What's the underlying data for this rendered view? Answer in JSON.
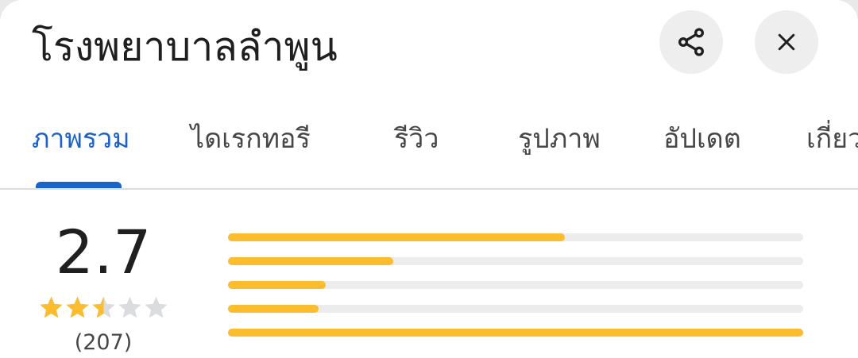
{
  "header": {
    "title": "โรงพยาบาลลำพูน"
  },
  "tabs": [
    {
      "label": "ภาพรวม",
      "active": true
    },
    {
      "label": "ไดเรกทอรี",
      "active": false
    },
    {
      "label": "รีวิว",
      "active": false
    },
    {
      "label": "รูปภาพ",
      "active": false
    },
    {
      "label": "อัปเดต",
      "active": false
    },
    {
      "label": "เกี่ยว",
      "active": false
    }
  ],
  "rating": {
    "value": "2.7",
    "stars_filled": 2.5,
    "stars_total": 5,
    "count": "(207)"
  },
  "rating_distribution": [
    {
      "stars": 5,
      "fraction": 0.585
    },
    {
      "stars": 4,
      "fraction": 0.287
    },
    {
      "stars": 3,
      "fraction": 0.17
    },
    {
      "stars": 2,
      "fraction": 0.158
    },
    {
      "stars": 1,
      "fraction": 1.0
    }
  ],
  "colors": {
    "accent": "#1a64c9",
    "star": "#fbbc2e",
    "star_empty": "#dadce0",
    "bar_track": "#ececec"
  },
  "icons": {
    "share": "share-icon",
    "close": "close-icon",
    "star": "star-icon"
  }
}
